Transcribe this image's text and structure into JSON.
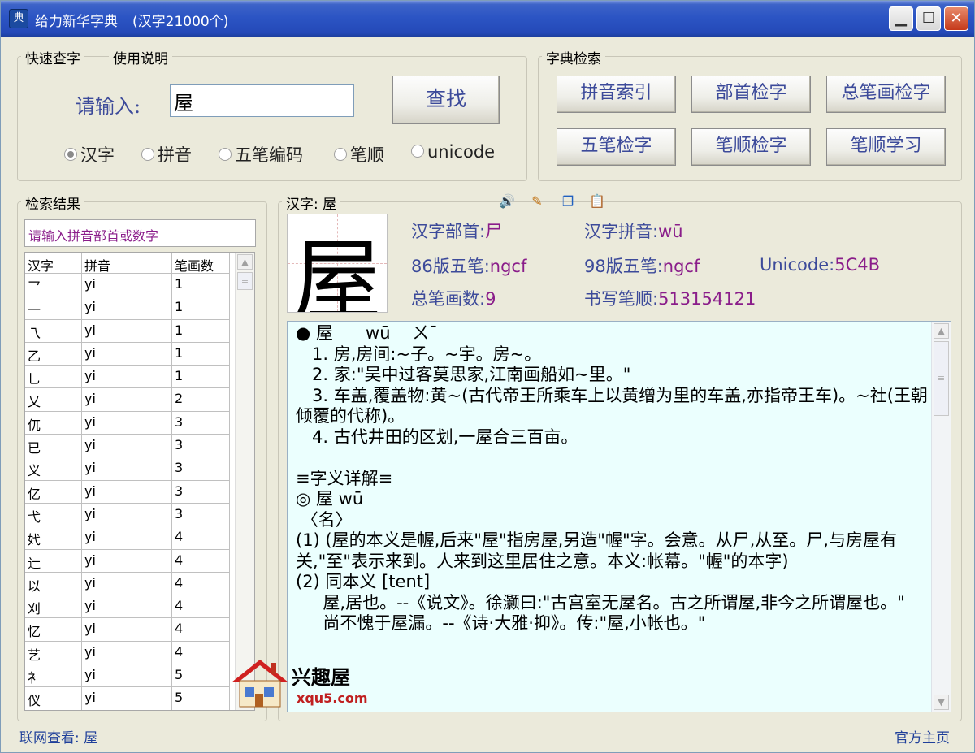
{
  "window": {
    "title": "给力新华字典",
    "subtitle": "(汉字21000个)"
  },
  "quick_search": {
    "tab_quick": "快速查字",
    "tab_help": "使用说明",
    "label": "请输入:",
    "value": "屋",
    "find_button": "查找",
    "radios": [
      {
        "label": "汉字",
        "checked": true
      },
      {
        "label": "拼音",
        "checked": false
      },
      {
        "label": "五笔编码",
        "checked": false
      },
      {
        "label": "笔顺",
        "checked": false
      },
      {
        "label": "unicode",
        "checked": false
      }
    ]
  },
  "dictionary_search": {
    "title": "字典检索",
    "buttons": [
      "拼音索引",
      "部首检字",
      "总笔画检字",
      "五笔检字",
      "笔顺检字",
      "笔顺学习"
    ]
  },
  "results": {
    "title": "检索结果",
    "filter_placeholder": "请输入拼音部首或数字",
    "columns": [
      "汉字",
      "拼音",
      "笔画数"
    ],
    "rows": [
      [
        "乛",
        "yi",
        "1"
      ],
      [
        "一",
        "yi",
        "1"
      ],
      [
        "乁",
        "yi",
        "1"
      ],
      [
        "乙",
        "yi",
        "1"
      ],
      [
        "乚",
        "yi",
        "1"
      ],
      [
        "乂",
        "yi",
        "2"
      ],
      [
        "㐳",
        "yi",
        "3"
      ],
      [
        "已",
        "yi",
        "3"
      ],
      [
        "义",
        "yi",
        "3"
      ],
      [
        "亿",
        "yi",
        "3"
      ],
      [
        "弋",
        "yi",
        "3"
      ],
      [
        "㚤",
        "yi",
        "4"
      ],
      [
        "辷",
        "yi",
        "4"
      ],
      [
        "以",
        "yi",
        "4"
      ],
      [
        "刈",
        "yi",
        "4"
      ],
      [
        "忆",
        "yi",
        "4"
      ],
      [
        "艺",
        "yi",
        "4"
      ],
      [
        "衤",
        "yi",
        "5"
      ],
      [
        "仪",
        "yi",
        "5"
      ]
    ]
  },
  "character": {
    "section_title": "汉字: 屋",
    "glyph": "屋",
    "radical_label": "汉字部首:",
    "radical": "尸",
    "pinyin_label": "汉字拼音:",
    "pinyin": "wū",
    "wubi86_label": "86版五笔:",
    "wubi86": "ngcf",
    "wubi98_label": "98版五笔:",
    "wubi98": "ngcf",
    "unicode_label": "Unicode:",
    "unicode": "5C4B",
    "strokes_label": "总笔画数:",
    "strokes": "9",
    "order_label": "书写笔顺:",
    "order": "513154121",
    "icons": [
      "speaker-icon",
      "edit-book-icon",
      "copy-icon",
      "paste-icon"
    ]
  },
  "detail": {
    "lines": [
      "● 屋      wū    ㄨˉ",
      "   1. 房,房间:~子。~宇。房~。",
      "   2. 家:\"吴中过客莫思家,江南画船如~里。\"",
      "   3. 车盖,覆盖物:黄~(古代帝王所乘车上以黄缯为里的车盖,亦指帝王车)。~社(王朝倾覆的代称)。",
      "   4. 古代井田的区划,一屋合三百亩。",
      "",
      "≡字义详解≡",
      "◎ 屋 wū",
      " 〈名〉",
      "(1) (屋的本义是幄,后来\"屋\"指房屋,另造\"幄\"字。会意。从尸,从至。尸,与房屋有关,\"至\"表示来到。人来到这里居住之意。本义:帐幕。\"幄\"的本字)",
      "(2) 同本义 [tent]",
      "     屋,居也。--《说文》。徐灏曰:\"古宫室无屋名。古之所谓屋,非今之所谓屋也。\"",
      "     尚不愧于屋漏。--《诗·大雅·抑》。传:\"屋,小帐也。\""
    ]
  },
  "watermark": {
    "text": "兴趣屋",
    "url": "xqu5.com"
  },
  "status": {
    "left": "联网查看: 屋",
    "right": "官方主页"
  }
}
